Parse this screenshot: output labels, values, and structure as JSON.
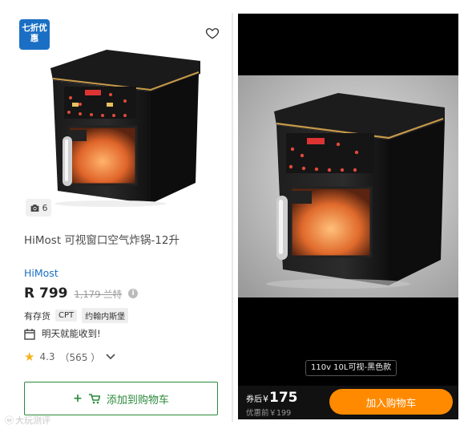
{
  "card": {
    "discount_badge": "七折优惠",
    "photo_count": "6",
    "title": "HiMost 可视窗口空气炸锅-12升",
    "brand": "HiMost",
    "price": "R 799",
    "old_price": "1,179 兰特",
    "stock": "有存货",
    "tags": [
      "CPT",
      "约翰内斯堡"
    ],
    "delivery": "明天就能收到!",
    "rating": "4.3",
    "review_count": "（565 ）",
    "add_to_cart": "添加到购物车",
    "watermark": "大玩测评"
  },
  "phone": {
    "variant": "110v 10L可视-黑色款",
    "after_coupon_label": "券后",
    "currency": "¥",
    "after_coupon_price": "175",
    "before_coupon": "优惠前￥199",
    "buy_button": "加入购物车"
  },
  "colors": {
    "brand_blue": "#1a6fc4",
    "cart_green": "#2a8a3a",
    "buy_orange": "#ff8a00",
    "star_gold": "#f5b21d"
  },
  "icons": [
    "heart-icon",
    "camera-icon",
    "calendar-icon",
    "star-icon",
    "chevron-down-icon",
    "plus-icon",
    "cart-icon",
    "info-icon",
    "weibo-icon"
  ]
}
